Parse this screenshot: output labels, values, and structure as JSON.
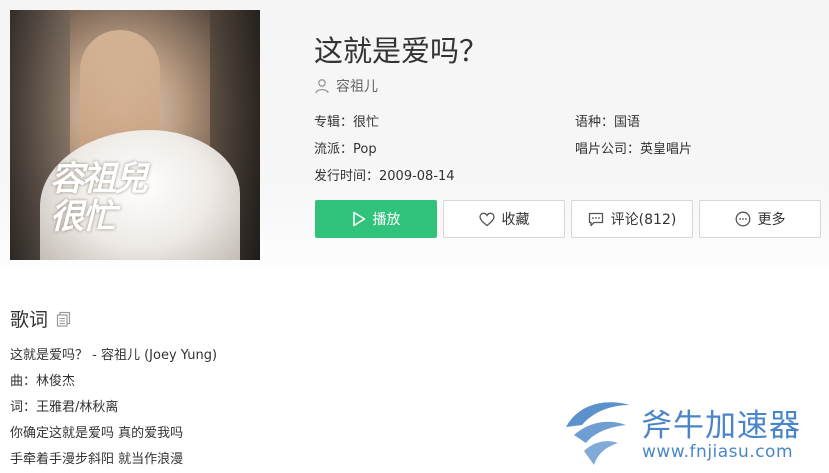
{
  "song": {
    "title": "这就是爱吗？",
    "artist": "容祖儿"
  },
  "cover": {
    "text_line1": "容祖兒",
    "text_line2": "很忙"
  },
  "meta": {
    "album": "专辑：很忙",
    "genre": "流派：Pop",
    "release": "发行时间：2009-08-14",
    "language": "语种：国语",
    "label": "唱片公司：英皇唱片"
  },
  "buttons": {
    "play": "播放",
    "favorite": "收藏",
    "comment": "评论(812)",
    "more": "更多"
  },
  "lyrics": {
    "header": "歌词",
    "lines": [
      "这就是爱吗？ - 容祖儿 (Joey Yung)",
      "曲：林俊杰",
      "词：王雅君/林秋离",
      "你确定这就是爱吗 真的爱我吗",
      "手牵着手漫步斜阳 就当作浪漫"
    ]
  },
  "watermark": {
    "title": "斧牛加速器",
    "url": "www.fnjiasu.com"
  },
  "colors": {
    "accent": "#31c27c",
    "watermark": "#4a86c7",
    "text": "#333333"
  }
}
